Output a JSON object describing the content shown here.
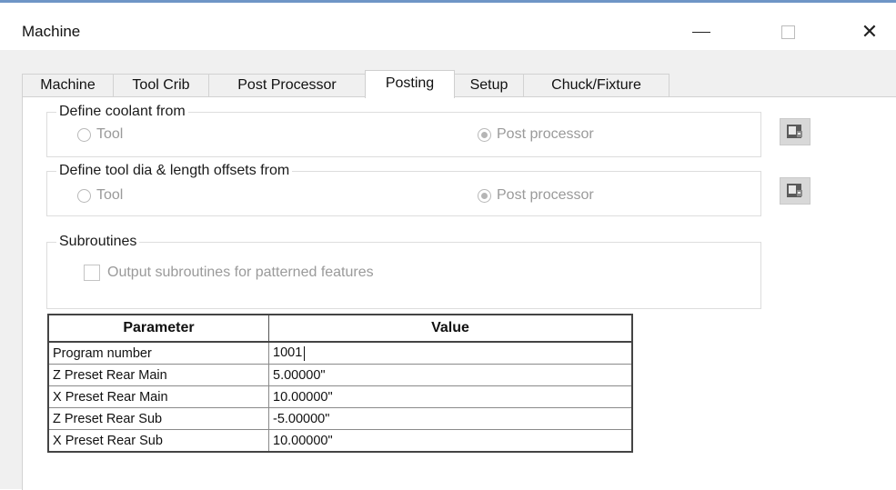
{
  "window": {
    "title": "Machine",
    "minimize_icon": "minimize-icon",
    "maximize_icon": "maximize-icon",
    "close_icon": "close-icon",
    "close_glyph": "✕"
  },
  "tabs": [
    {
      "label": "Machine",
      "active": false
    },
    {
      "label": "Tool Crib",
      "active": false
    },
    {
      "label": "Post Processor",
      "active": false
    },
    {
      "label": "Posting",
      "active": true
    },
    {
      "label": "Setup",
      "active": false
    },
    {
      "label": "Chuck/Fixture",
      "active": false
    }
  ],
  "coolant_group": {
    "label": "Define coolant from",
    "option_tool": "Tool",
    "option_post": "Post processor",
    "selected": "Post processor"
  },
  "offsets_group": {
    "label": "Define tool dia & length offsets from",
    "option_tool": "Tool",
    "option_post": "Post processor",
    "selected": "Post processor"
  },
  "subroutines_group": {
    "label": "Subroutines",
    "checkbox_label": "Output subroutines for patterned features",
    "checked": false
  },
  "side_buttons": {
    "icon": "machine-properties-icon"
  },
  "parameters_table": {
    "headers": [
      "Parameter",
      "Value"
    ],
    "rows": [
      [
        "Program number",
        "1001"
      ],
      [
        "Z Preset Rear Main",
        "5.00000\""
      ],
      [
        "X Preset Rear Main",
        "10.00000\""
      ],
      [
        "Z Preset Rear Sub",
        "-5.00000\""
      ],
      [
        "X Preset Rear Sub",
        "10.00000\""
      ]
    ]
  },
  "colors": {
    "accent_line": "#6f95c6",
    "client_bg": "#f0f0f0",
    "disabled_text": "#9a9a9a"
  }
}
